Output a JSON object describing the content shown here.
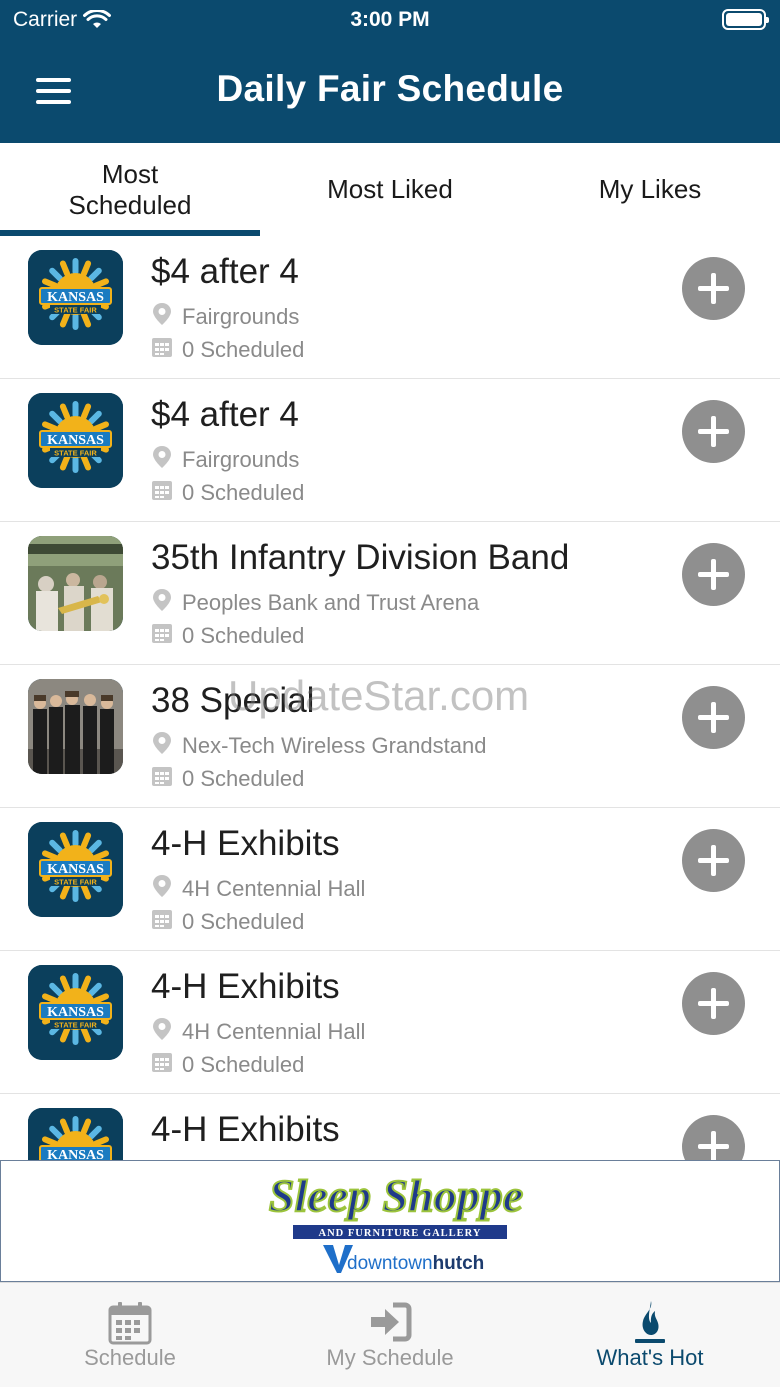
{
  "status_bar": {
    "carrier": "Carrier",
    "time": "3:00 PM"
  },
  "header": {
    "title": "Daily Fair Schedule",
    "menu_icon": "hamburger-menu-icon"
  },
  "tabs": [
    {
      "label": "Most Scheduled",
      "active": true
    },
    {
      "label": "Most Liked",
      "active": false
    },
    {
      "label": "My Likes",
      "active": false
    }
  ],
  "events": [
    {
      "title": "$4 after 4",
      "location": "Fairgrounds",
      "scheduled": "0 Scheduled",
      "thumb": "kansas-state-fair-logo"
    },
    {
      "title": "$4 after 4",
      "location": "Fairgrounds",
      "scheduled": "0 Scheduled",
      "thumb": "kansas-state-fair-logo"
    },
    {
      "title": "35th Infantry Division Band",
      "location": "Peoples Bank and Trust Arena",
      "scheduled": "0 Scheduled",
      "thumb": "band-photo"
    },
    {
      "title": "38 Special",
      "location": "Nex-Tech Wireless Grandstand",
      "scheduled": "0 Scheduled",
      "thumb": "group-photo"
    },
    {
      "title": "4-H Exhibits",
      "location": "4H Centennial Hall",
      "scheduled": "0 Scheduled",
      "thumb": "kansas-state-fair-logo"
    },
    {
      "title": "4-H Exhibits",
      "location": "4H Centennial Hall",
      "scheduled": "0 Scheduled",
      "thumb": "kansas-state-fair-logo"
    },
    {
      "title": "4-H Exhibits",
      "location": "",
      "scheduled": "",
      "thumb": "kansas-state-fair-logo"
    }
  ],
  "logo_text": {
    "kansas": "KANSAS",
    "state_fair": "STATE FAIR"
  },
  "ad": {
    "brand": "Sleep Shoppe",
    "tagline": "AND FURNITURE GALLERY",
    "sponsor": "downtownhutch",
    "sponsor_prefix": "downtown",
    "sponsor_suffix": "hutch"
  },
  "watermark": "UpdateStar.com",
  "tabbar": [
    {
      "label": "Schedule",
      "icon": "calendar-icon",
      "active": false
    },
    {
      "label": "My Schedule",
      "icon": "sign-in-icon",
      "active": false
    },
    {
      "label": "What's Hot",
      "icon": "flame-icon",
      "active": true
    }
  ],
  "colors": {
    "primary": "#0b4a6e",
    "add_button": "#8f8f8f",
    "muted_text": "#8a8a8a"
  }
}
